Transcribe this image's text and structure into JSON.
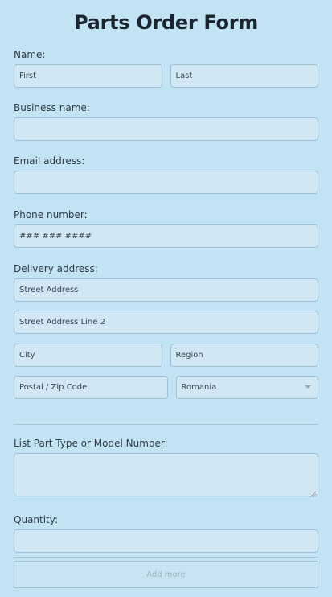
{
  "form": {
    "title": "Parts Order Form",
    "name": {
      "label": "Name:",
      "first_placeholder": "First",
      "last_placeholder": "Last"
    },
    "business": {
      "label": "Business name:",
      "value": ""
    },
    "email": {
      "label": "Email address:",
      "value": ""
    },
    "phone": {
      "label": "Phone number:",
      "placeholder": "### ### ####"
    },
    "delivery": {
      "label": "Delivery address:",
      "street_placeholder": "Street Address",
      "street2_placeholder": "Street Address Line 2",
      "city_placeholder": "City",
      "region_placeholder": "Region",
      "postal_placeholder": "Postal / Zip Code",
      "country_selected": "Romania"
    },
    "parts": {
      "label": "List Part Type or Model Number:",
      "value": ""
    },
    "quantity": {
      "label": "Quantity:",
      "value": ""
    },
    "add_more_label": "Add more"
  },
  "colors": {
    "background": "#c2e3f3",
    "field_fill": "#d1e7f3",
    "field_border": "#9ec1d6",
    "muted_text": "#9eb2bf"
  }
}
